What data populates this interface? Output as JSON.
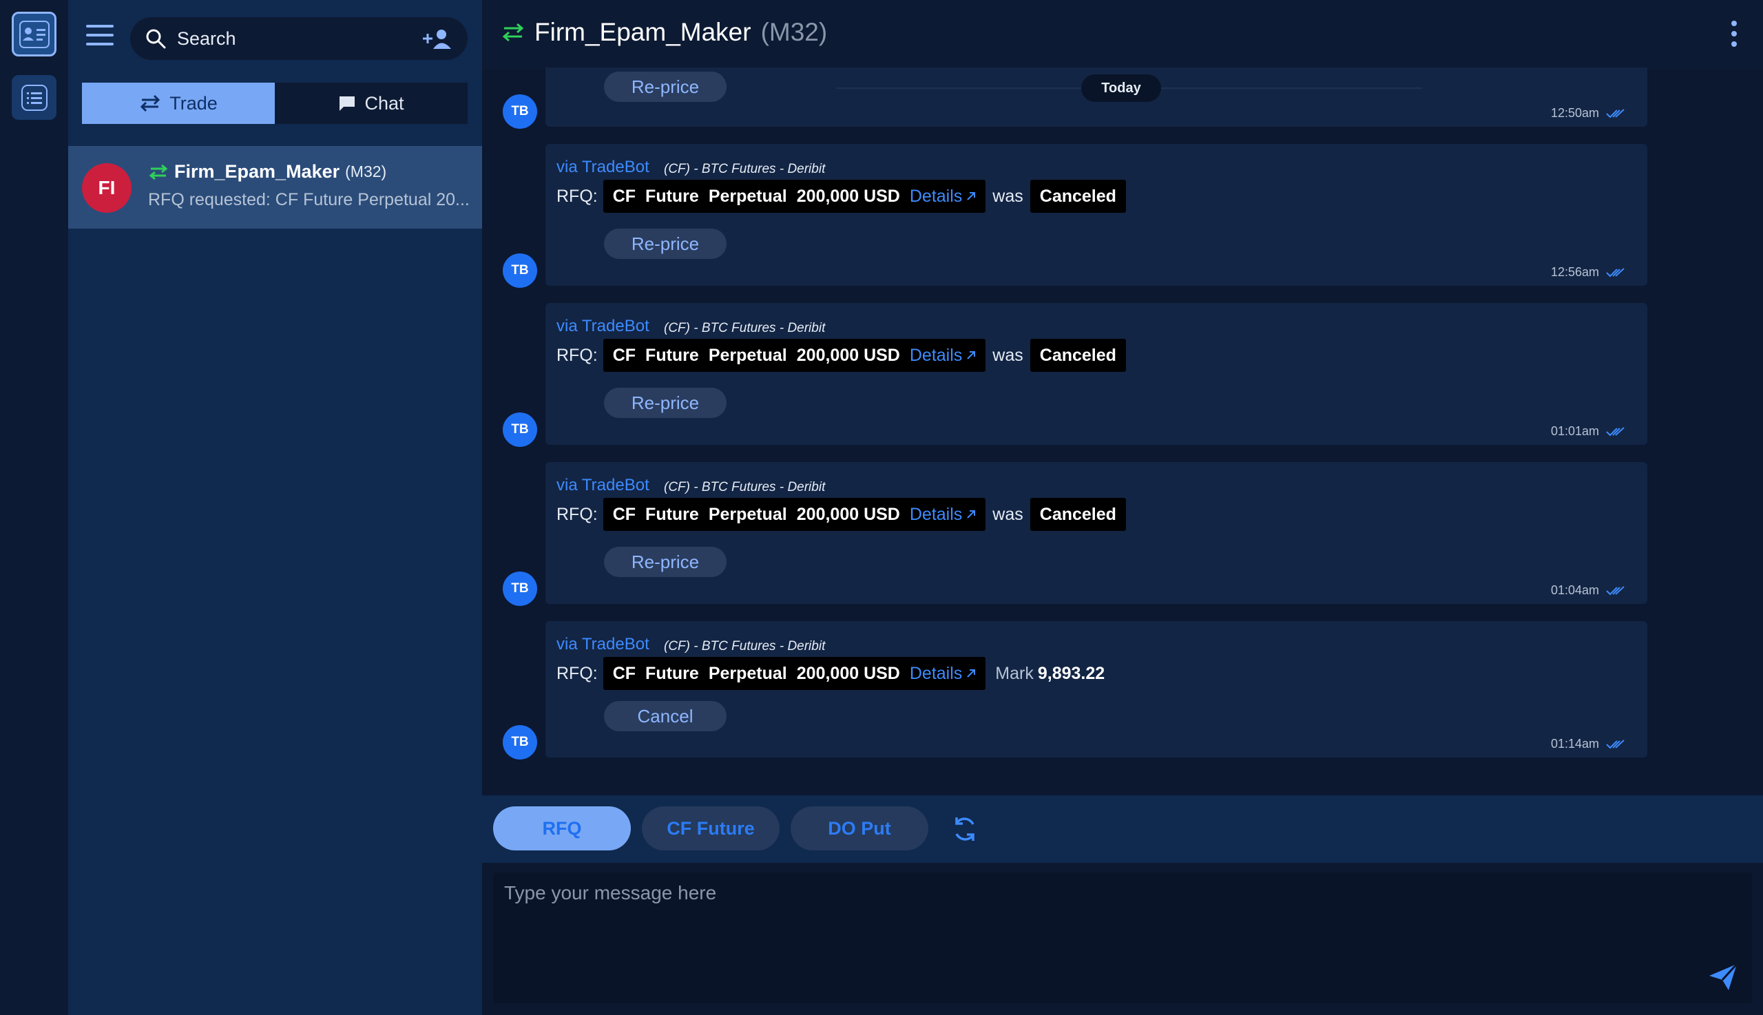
{
  "rail": {
    "profile_icon": "contact-card-icon",
    "list_icon": "list-icon"
  },
  "sidebar": {
    "search_placeholder": "Search",
    "tabs": [
      {
        "label": "Trade",
        "icon": "swap-arrows-icon"
      },
      {
        "label": "Chat",
        "icon": "chat-bubble-icon"
      }
    ],
    "conversation": {
      "initials": "FI",
      "name": "Firm_Epam_Maker",
      "code": "(M32)",
      "preview": "RFQ requested: CF Future Perpetual 20..."
    }
  },
  "header": {
    "title": "Firm_Epam_Maker",
    "code": "(M32)"
  },
  "divider": {
    "label": "Today"
  },
  "messages": [
    {
      "avatar": "TB",
      "button": "Re-price",
      "time": "12:50am"
    },
    {
      "avatar": "TB",
      "via": "via TradeBot",
      "source": "(CF) - BTC Futures - Deribit",
      "rfq_label": "RFQ:",
      "t1": "CF",
      "t2": "Future",
      "t3": "Perpetual",
      "amount": "200,000 USD",
      "details": "Details",
      "was": "was",
      "status": "Canceled",
      "button": "Re-price",
      "time": "12:56am"
    },
    {
      "avatar": "TB",
      "via": "via TradeBot",
      "source": "(CF) - BTC Futures - Deribit",
      "rfq_label": "RFQ:",
      "t1": "CF",
      "t2": "Future",
      "t3": "Perpetual",
      "amount": "200,000 USD",
      "details": "Details",
      "was": "was",
      "status": "Canceled",
      "button": "Re-price",
      "time": "01:01am"
    },
    {
      "avatar": "TB",
      "via": "via TradeBot",
      "source": "(CF) - BTC Futures - Deribit",
      "rfq_label": "RFQ:",
      "t1": "CF",
      "t2": "Future",
      "t3": "Perpetual",
      "amount": "200,000 USD",
      "details": "Details",
      "was": "was",
      "status": "Canceled",
      "button": "Re-price",
      "time": "01:04am"
    },
    {
      "avatar": "TB",
      "via": "via TradeBot",
      "source": "(CF) - BTC Futures - Deribit",
      "rfq_label": "RFQ:",
      "t1": "CF",
      "t2": "Future",
      "t3": "Perpetual",
      "amount": "200,000 USD",
      "details": "Details",
      "mark_label": "Mark",
      "mark_value": "9,893.22",
      "button": "Cancel",
      "time": "01:14am"
    }
  ],
  "quick_actions": [
    "RFQ",
    "CF Future",
    "DO Put"
  ],
  "composer": {
    "placeholder": "Type your message here"
  },
  "colors": {
    "accent": "#3d8bff",
    "trade_green": "#2fd15a",
    "avatar_red": "#cc1f3e",
    "tb_blue": "#1f6ff2"
  }
}
